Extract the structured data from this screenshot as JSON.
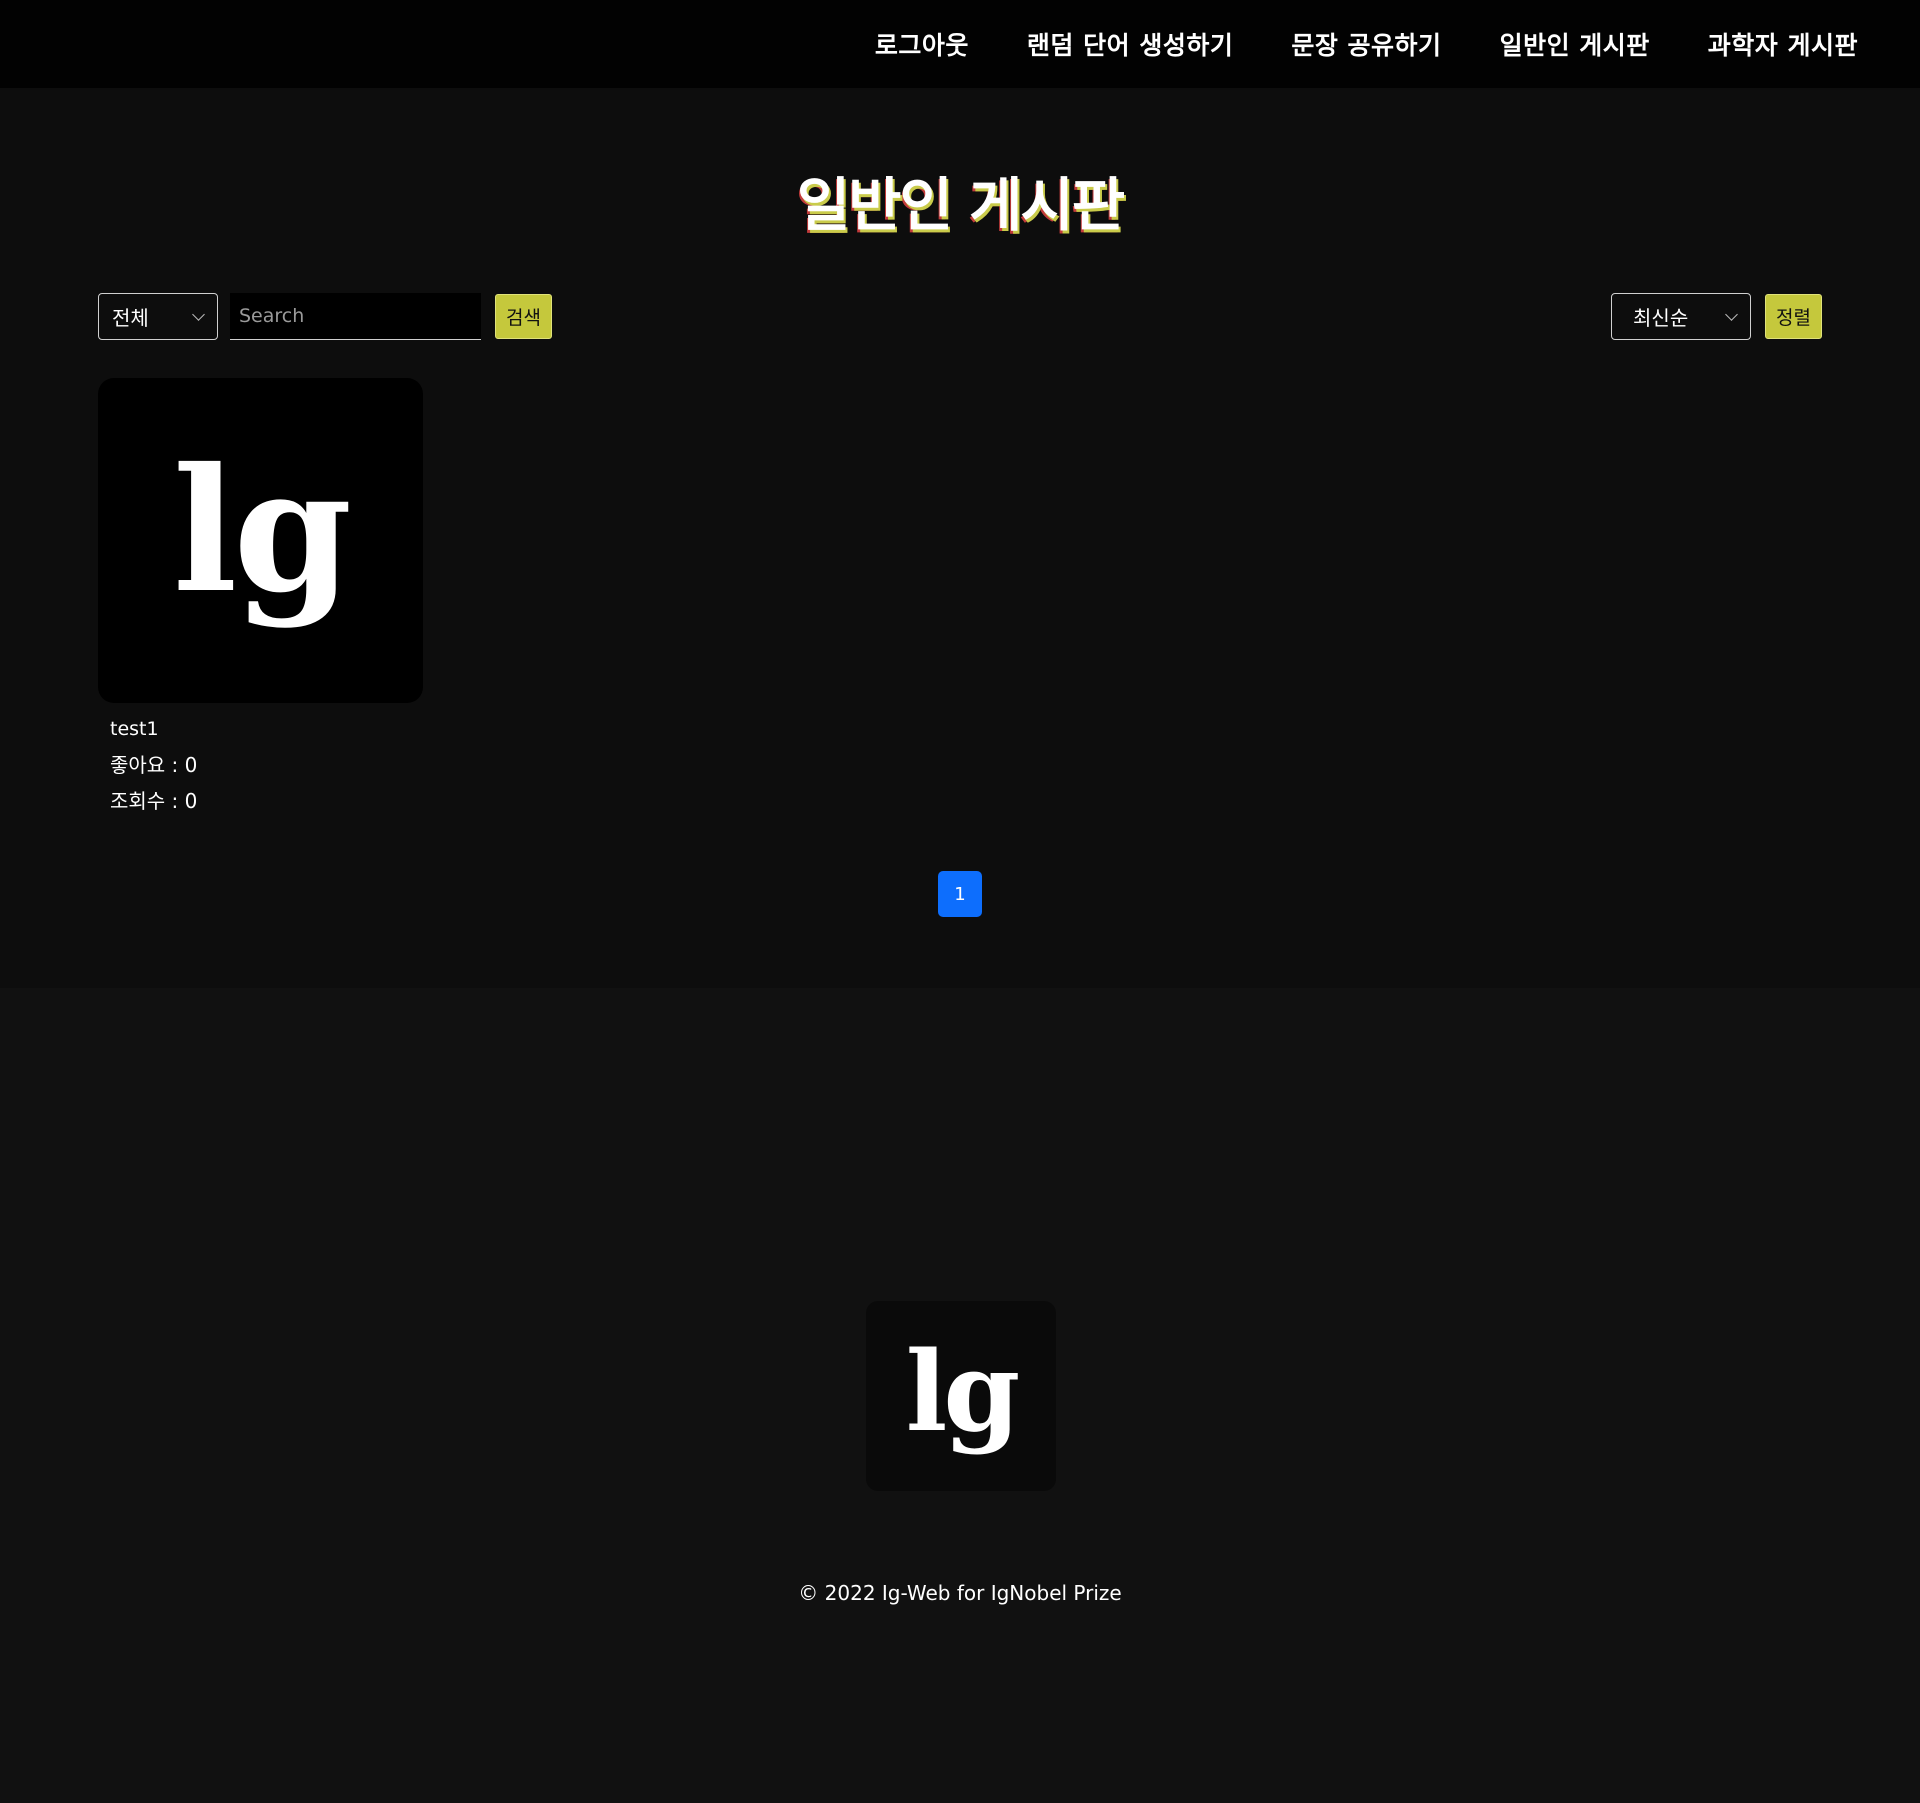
{
  "nav": {
    "items": [
      {
        "label": "로그아웃"
      },
      {
        "label": "랜덤 단어 생성하기"
      },
      {
        "label": "문장 공유하기"
      },
      {
        "label": "일반인 게시판"
      },
      {
        "label": "과학자 게시판"
      }
    ]
  },
  "page": {
    "title": "일반인 게시판"
  },
  "search": {
    "filter_selected": "전체",
    "placeholder": "Search",
    "value": "",
    "button_label": "검색"
  },
  "sort": {
    "selected": "최신순",
    "button_label": "정렬"
  },
  "posts": [
    {
      "thumbnail_text": "lg",
      "title": "test1",
      "likes": "좋아요 : 0",
      "views": "조회수 : 0"
    }
  ],
  "pagination": {
    "current": "1"
  },
  "footer": {
    "logo_text": "lg",
    "copyright": "© 2022 Ig-Web for IgNobel Prize"
  },
  "colors": {
    "accent_yellow": "#c5c83c",
    "page_active": "#0d6efd",
    "background": "#0d0d0d",
    "navbar": "#020202"
  }
}
